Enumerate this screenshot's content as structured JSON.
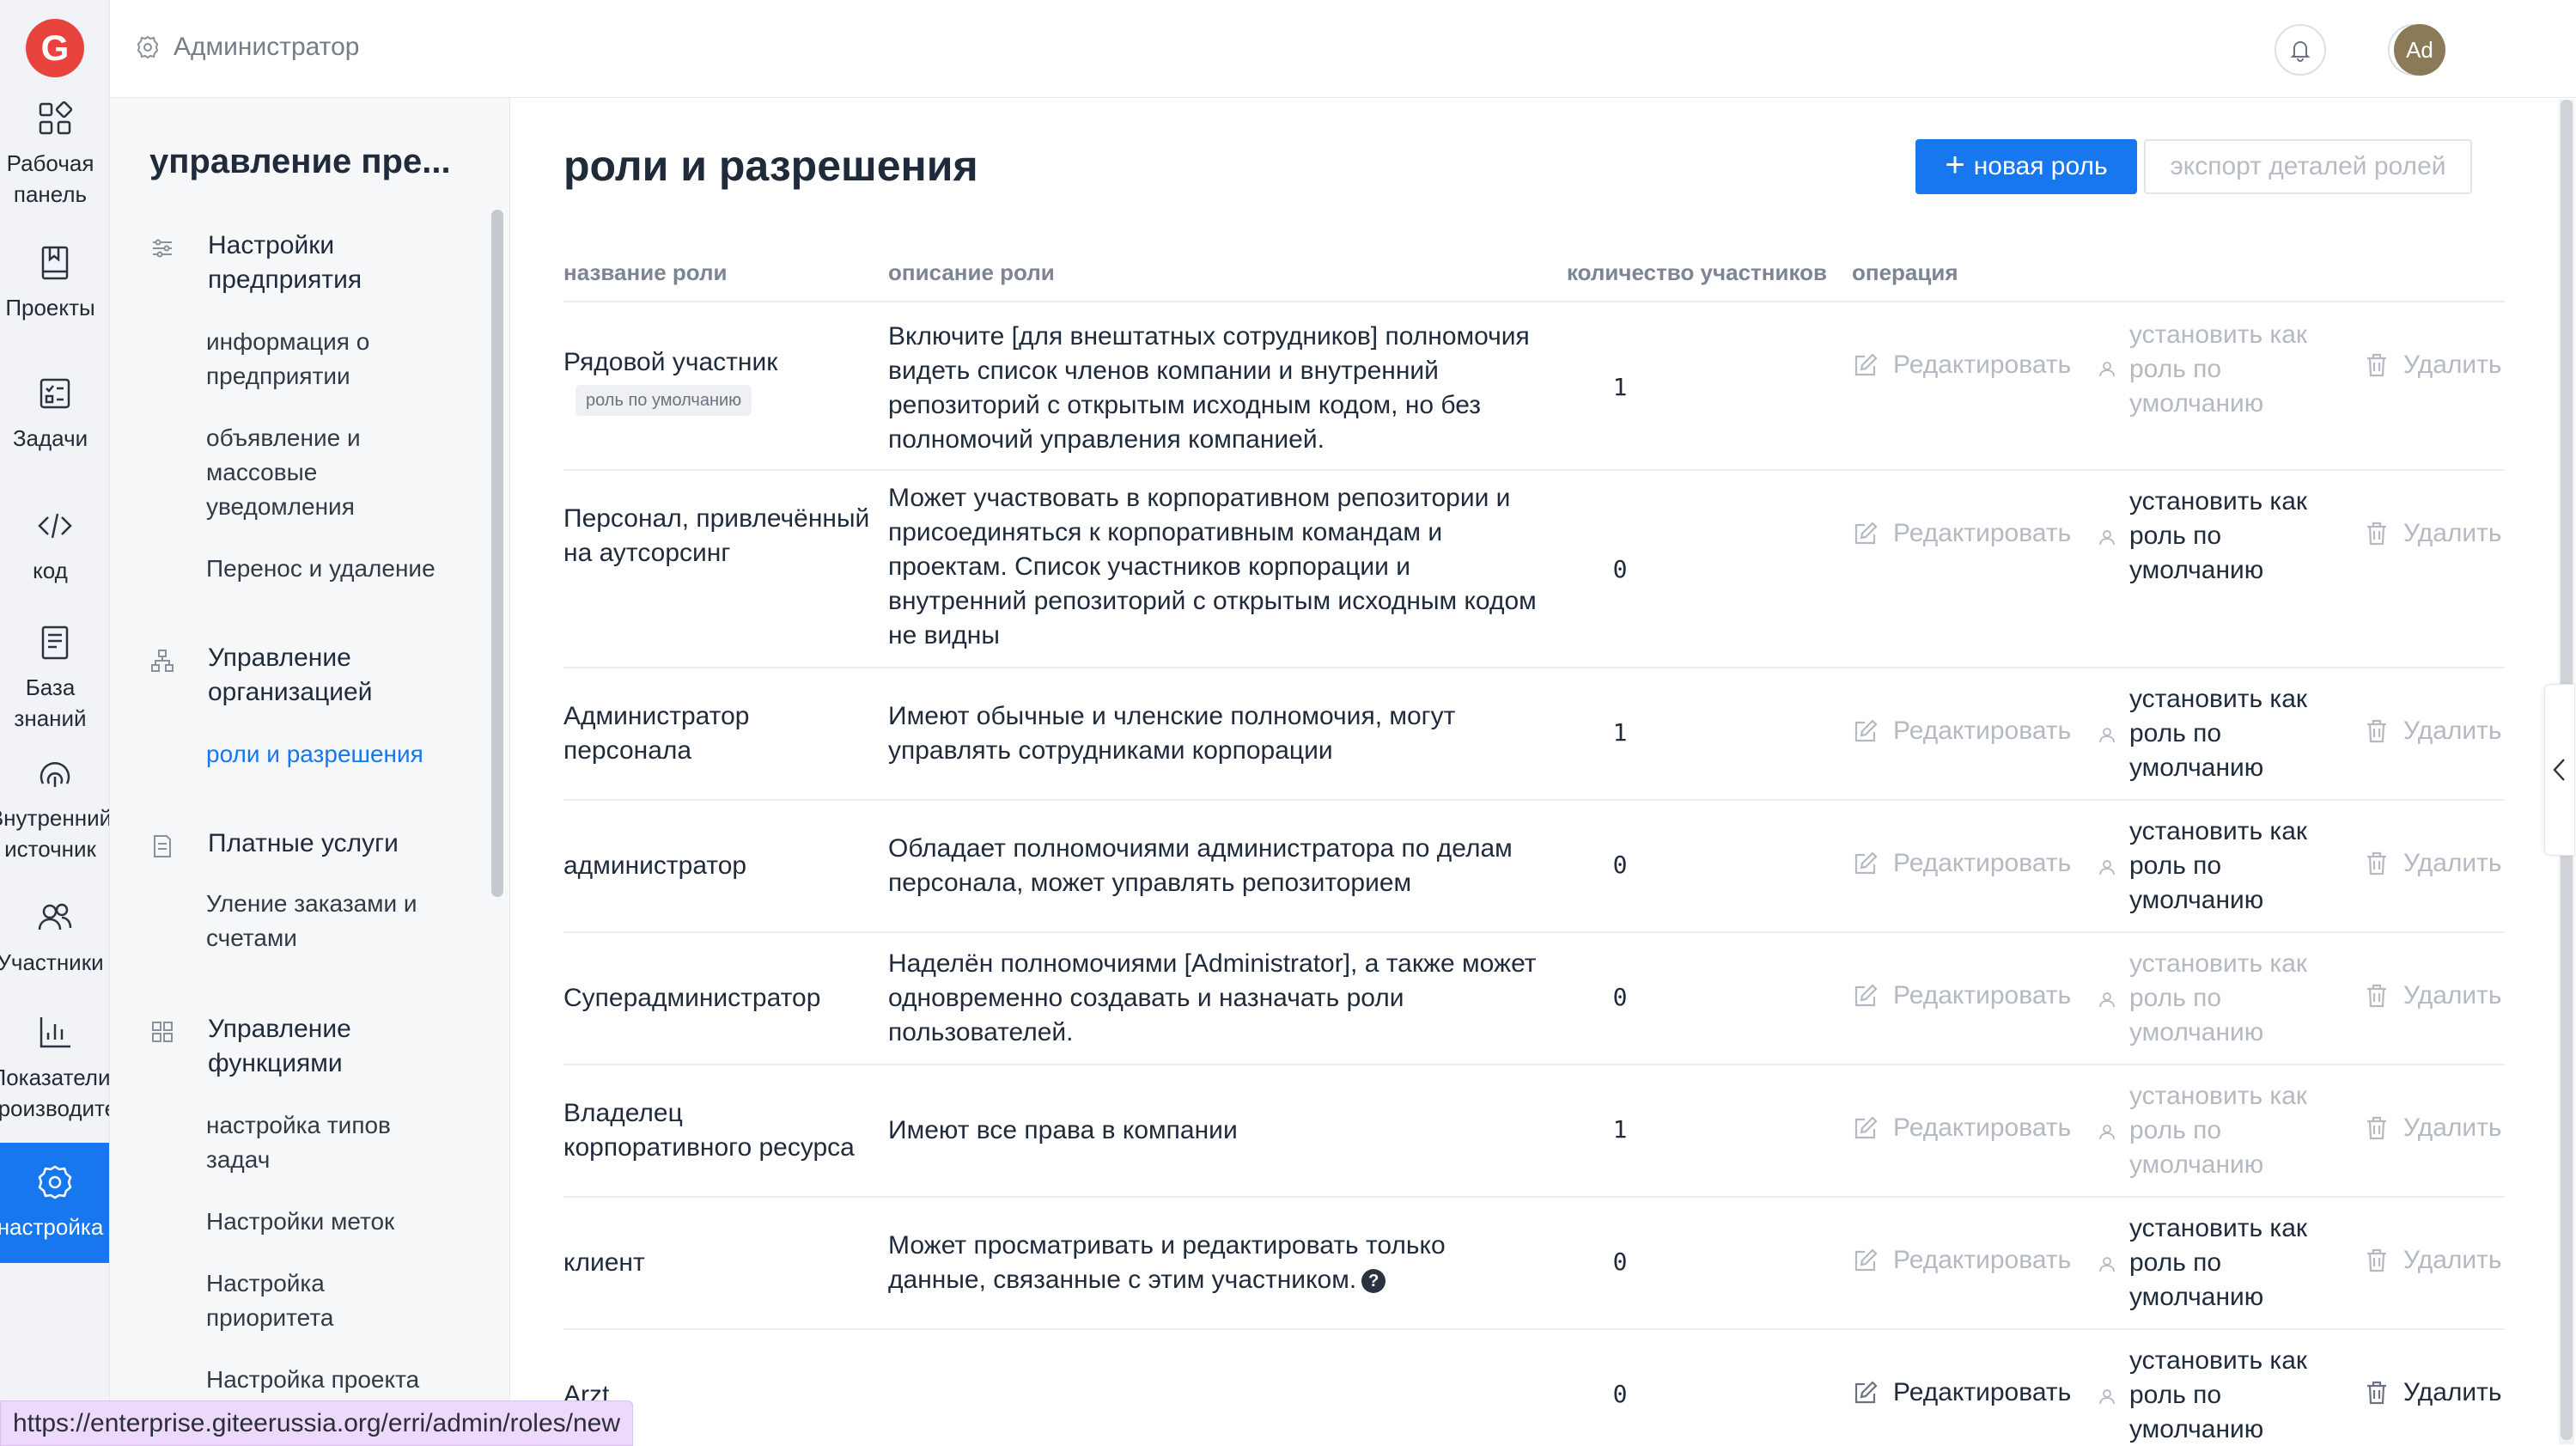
{
  "rail": {
    "items": [
      {
        "label": "Рабочая\nпанель",
        "icon": "dashboard-icon"
      },
      {
        "label": "Проекты",
        "icon": "book-icon"
      },
      {
        "label": "Задачи",
        "icon": "task-icon"
      },
      {
        "label": "код",
        "icon": "code-icon"
      },
      {
        "label": "База\nзнаний",
        "icon": "document-icon"
      },
      {
        "label": "Внутренний\nисточник",
        "icon": "source-icon"
      },
      {
        "label": "Участники",
        "icon": "users-icon"
      },
      {
        "label": "Показатели\nпроизводитель",
        "icon": "chart-icon"
      },
      {
        "label": "настройка",
        "icon": "gear-icon"
      }
    ]
  },
  "header": {
    "breadcrumb": "Администратор",
    "avatar": "Ad"
  },
  "sidebar": {
    "title": "управление пре...",
    "groups": [
      {
        "label": "Настройки предприятия",
        "items": [
          "информация о предприятии",
          "объявление и массовые уведомления",
          "Перенос и удаление"
        ]
      },
      {
        "label": "Управление организацией",
        "items": [
          "роли и разрешения"
        ]
      },
      {
        "label": "Платные услуги",
        "items": [
          "Уление заказами и счетами"
        ]
      },
      {
        "label": "Управление функциями",
        "items": [
          "настройка типов задач",
          "Настройки меток",
          "Настройка приоритета",
          "Настройка проекта"
        ]
      }
    ]
  },
  "main": {
    "title": "роли и разрешения",
    "new_role": "новая роль",
    "export": "экспорт деталей ролей",
    "columns": [
      "название роли",
      "описание роли",
      "количество участников",
      "операция"
    ],
    "edit_label": "Редактировать",
    "default_label": "установить как роль по умолчанию",
    "delete_label": "Удалить",
    "default_badge": "роль по умолчанию",
    "rows": [
      {
        "name": "Рядовой участник",
        "desc": "Включите [для внештатных сотрудников] полномочия видеть список членов компании и внутренний репозиторий с открытым исходным кодом, но без полномочий управления компанией.",
        "count": "1"
      },
      {
        "name": "Персонал, привлечённый на аутсорсинг",
        "desc": "Может участвовать в корпоративном репозитории и присоединяться к корпоративным командам и проектам. Список участников корпорации и внутренний репозиторий с открытым исходным кодом не видны",
        "count": "0"
      },
      {
        "name": "Администратор персонала",
        "desc": "Имеют обычные и членские полномочия, могут управлять сотрудниками корпорации",
        "count": "1"
      },
      {
        "name": "администратор",
        "desc": "Обладает полномочиями администратора по делам персонала, может управлять репозиторием",
        "count": "0"
      },
      {
        "name": "Суперадминистратор",
        "desc": "Наделён полномочиями [Administrator], а также может одновременно создавать и назначать роли пользователей.",
        "count": "0"
      },
      {
        "name": "Владелец корпоративного ресурса",
        "desc": "Имеют все права в компании",
        "count": "1"
      },
      {
        "name": "клиент",
        "desc": "Может просматривать и редактировать только данные, связанные с этим участником.",
        "count": "0"
      },
      {
        "name": "Arzt",
        "desc": "",
        "count": "0"
      }
    ]
  },
  "statusbar": {
    "url": "https://enterprise.giteerussia.org/erri/admin/roles/new"
  },
  "colors": {
    "accent": "#1677ee",
    "logo": "#e8433c",
    "muted": "#b4b9c2"
  }
}
